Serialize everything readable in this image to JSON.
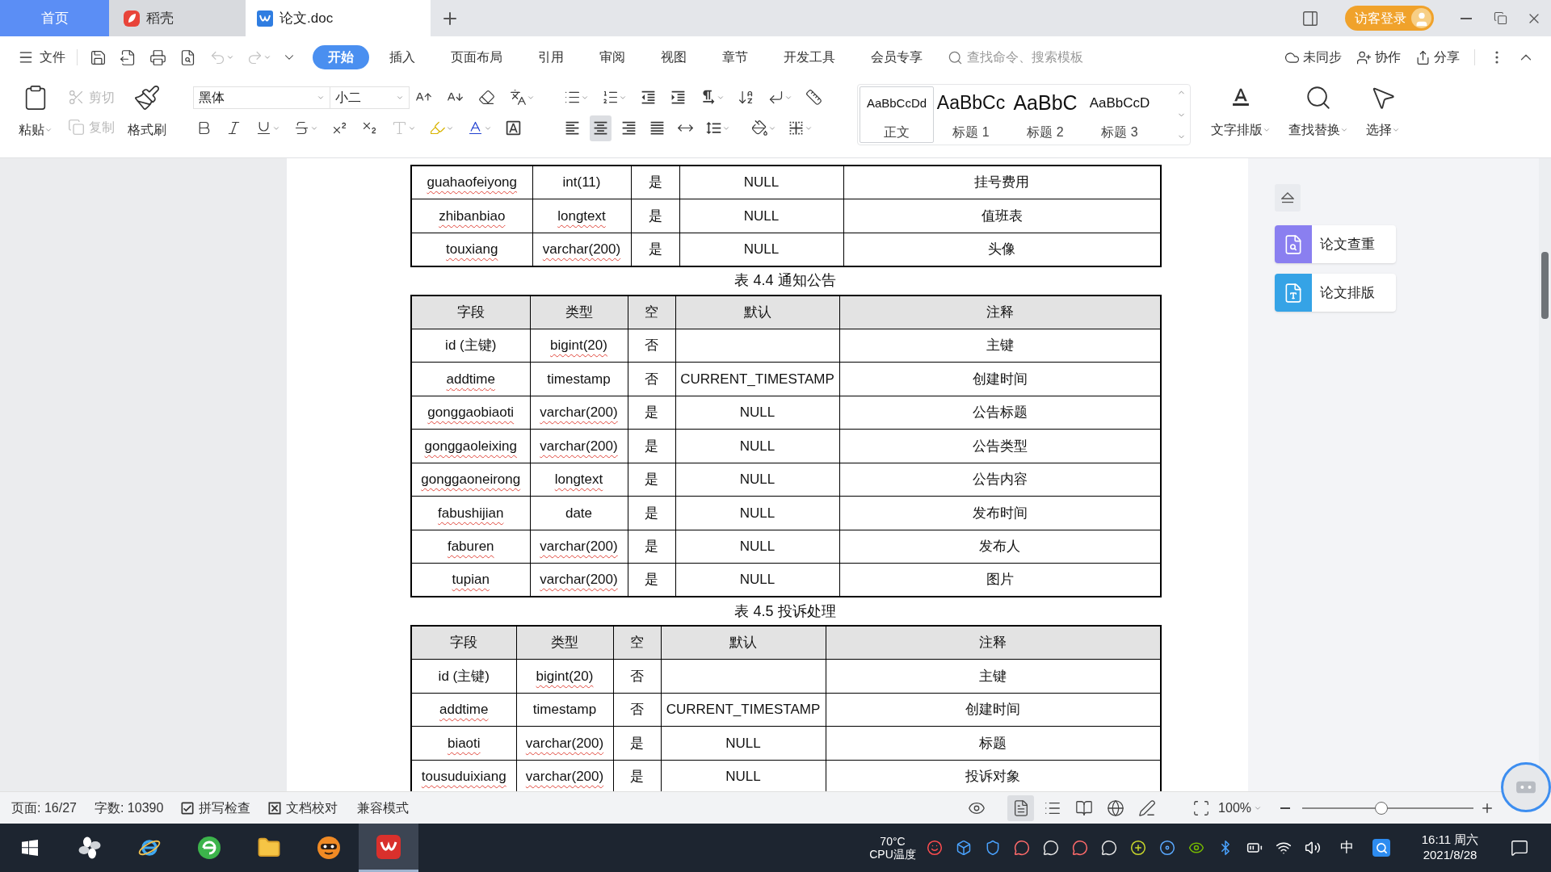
{
  "tabs": [
    {
      "kind": "home",
      "label": "首页",
      "selected": false
    },
    {
      "kind": "app",
      "label": "稻壳",
      "selected": false
    },
    {
      "kind": "document",
      "label": "论文.doc",
      "selected": true
    }
  ],
  "account": {
    "label": "访客登录"
  },
  "menu": {
    "file": "文件",
    "undo": {
      "disabled": true
    },
    "redo": {
      "disabled": true
    },
    "tabs": [
      {
        "label": "开始",
        "selected": true
      },
      {
        "label": "插入",
        "selected": false
      },
      {
        "label": "页面布局",
        "selected": false
      },
      {
        "label": "引用",
        "selected": false
      },
      {
        "label": "审阅",
        "selected": false
      },
      {
        "label": "视图",
        "selected": false
      },
      {
        "label": "章节",
        "selected": false
      },
      {
        "label": "开发工具",
        "selected": false
      },
      {
        "label": "会员专享",
        "selected": false
      }
    ],
    "search": {
      "placeholder": "查找命令、搜索模板"
    },
    "actions": [
      {
        "kind": "sync",
        "label": "未同步"
      },
      {
        "kind": "collaborate",
        "label": "协作"
      },
      {
        "kind": "share",
        "label": "分享"
      }
    ]
  },
  "ribbon": {
    "clipboard": [
      {
        "kind": "paste",
        "label": "粘贴",
        "disabled": false
      },
      {
        "kind": "cut",
        "label": "剪切",
        "disabled": true
      },
      {
        "kind": "copy",
        "label": "复制",
        "disabled": true
      },
      {
        "kind": "format_painter",
        "label": "格式刷",
        "disabled": false
      }
    ],
    "font": {
      "name": "黑体",
      "size": "小二"
    },
    "text_effect": {
      "disabled": true
    },
    "alignment": [
      {
        "kind": "left",
        "selected": false
      },
      {
        "kind": "center",
        "selected": true
      },
      {
        "kind": "right",
        "selected": false
      },
      {
        "kind": "justify",
        "selected": false
      },
      {
        "kind": "distributed",
        "selected": false
      }
    ],
    "styles": [
      {
        "sample": "AaBbCcDd",
        "label": "正文",
        "selected": true
      },
      {
        "sample": "AaBbCc",
        "label": "标题 1",
        "selected": false
      },
      {
        "sample": "AaBbC",
        "label": "标题 2",
        "selected": false
      },
      {
        "sample": "AaBbCcD",
        "label": "标题 3",
        "selected": false
      }
    ],
    "tools": [
      {
        "kind": "text_layout",
        "label": "文字排版"
      },
      {
        "kind": "find_replace",
        "label": "查找替换"
      },
      {
        "kind": "select",
        "label": "选择"
      }
    ]
  },
  "document": {
    "tables": [
      {
        "rows": [
          {
            "cells": [
              "guahaofeiyong",
              "int(11)",
              "是",
              "NULL",
              "挂号费用"
            ],
            "misspelled": [
              true,
              false,
              false,
              false,
              false
            ]
          },
          {
            "cells": [
              "zhibanbiao",
              "longtext",
              "是",
              "NULL",
              "值班表"
            ],
            "misspelled": [
              true,
              true,
              false,
              false,
              false
            ]
          },
          {
            "cells": [
              "touxiang",
              "varchar(200)",
              "是",
              "NULL",
              "头像"
            ],
            "misspelled": [
              true,
              true,
              false,
              false,
              false
            ]
          }
        ]
      },
      {
        "caption": "表 4.4 通知公告",
        "header": [
          "字段",
          "类型",
          "空",
          "默认",
          "注释"
        ],
        "rows": [
          {
            "cells": [
              "id (主键)",
              "bigint(20)",
              "否",
              null,
              "主键"
            ],
            "misspelled": [
              false,
              true,
              false,
              false,
              false
            ]
          },
          {
            "cells": [
              "addtime",
              "timestamp",
              "否",
              "CURRENT_TIMESTAMP",
              "创建时间"
            ],
            "misspelled": [
              true,
              false,
              false,
              false,
              false
            ]
          },
          {
            "cells": [
              "gonggaobiaoti",
              "varchar(200)",
              "是",
              "NULL",
              "公告标题"
            ],
            "misspelled": [
              true,
              true,
              false,
              false,
              false
            ]
          },
          {
            "cells": [
              "gonggaoleixing",
              "varchar(200)",
              "是",
              "NULL",
              "公告类型"
            ],
            "misspelled": [
              true,
              true,
              false,
              false,
              false
            ]
          },
          {
            "cells": [
              "gonggaoneirong",
              "longtext",
              "是",
              "NULL",
              "公告内容"
            ],
            "misspelled": [
              true,
              true,
              false,
              false,
              false
            ]
          },
          {
            "cells": [
              "fabushijian",
              "date",
              "是",
              "NULL",
              "发布时间"
            ],
            "misspelled": [
              true,
              false,
              false,
              false,
              false
            ]
          },
          {
            "cells": [
              "faburen",
              "varchar(200)",
              "是",
              "NULL",
              "发布人"
            ],
            "misspelled": [
              true,
              true,
              false,
              false,
              false
            ]
          },
          {
            "cells": [
              "tupian",
              "varchar(200)",
              "是",
              "NULL",
              "图片"
            ],
            "misspelled": [
              true,
              true,
              false,
              false,
              false
            ]
          }
        ]
      },
      {
        "caption": "表 4.5 投诉处理",
        "header": [
          "字段",
          "类型",
          "空",
          "默认",
          "注释"
        ],
        "rows": [
          {
            "cells": [
              "id (主键)",
              "bigint(20)",
              "否",
              null,
              "主键"
            ],
            "misspelled": [
              false,
              true,
              false,
              false,
              false
            ]
          },
          {
            "cells": [
              "addtime",
              "timestamp",
              "否",
              "CURRENT_TIMESTAMP",
              "创建时间"
            ],
            "misspelled": [
              true,
              false,
              false,
              false,
              false
            ]
          },
          {
            "cells": [
              "biaoti",
              "varchar(200)",
              "是",
              "NULL",
              "标题"
            ],
            "misspelled": [
              true,
              true,
              false,
              false,
              false
            ]
          },
          {
            "cells": [
              "tousuduixiang",
              "varchar(200)",
              "是",
              "NULL",
              "投诉对象"
            ],
            "misspelled": [
              true,
              true,
              false,
              false,
              false
            ]
          }
        ]
      }
    ]
  },
  "side_panel": {
    "items": [
      {
        "kind": "check",
        "label": "论文查重",
        "color": "#8a7ff0"
      },
      {
        "kind": "layout",
        "label": "论文排版",
        "color": "#35a3e6"
      }
    ]
  },
  "status_bar": {
    "page": "页面: 16/27",
    "words": "字数: 10390",
    "checks": [
      {
        "kind": "spell",
        "label": "拼写检查"
      },
      {
        "kind": "proofread",
        "label": "文档校对"
      }
    ],
    "mode": "兼容模式",
    "views": [
      {
        "kind": "eye_care",
        "selected": false
      },
      {
        "kind": "page",
        "selected": true
      },
      {
        "kind": "outline",
        "selected": false
      },
      {
        "kind": "reading",
        "selected": false
      },
      {
        "kind": "web",
        "selected": false
      },
      {
        "kind": "writing",
        "selected": false
      }
    ],
    "zoom": {
      "label": "100%",
      "level": 0.46
    }
  },
  "taskbar": {
    "apps": [
      {
        "kind": "start",
        "selected": false
      },
      {
        "kind": "pinwheel",
        "selected": false
      },
      {
        "kind": "ring_browser",
        "selected": false
      },
      {
        "kind": "round_browser",
        "selected": false
      },
      {
        "kind": "explorer",
        "selected": false
      },
      {
        "kind": "mascot",
        "selected": false
      },
      {
        "kind": "office",
        "selected": true
      }
    ],
    "cpu": {
      "temperature": "70°C",
      "label": "CPU温度"
    },
    "ime": "中",
    "clock": {
      "time": "16:11 周六",
      "date": "2021/8/28"
    }
  }
}
